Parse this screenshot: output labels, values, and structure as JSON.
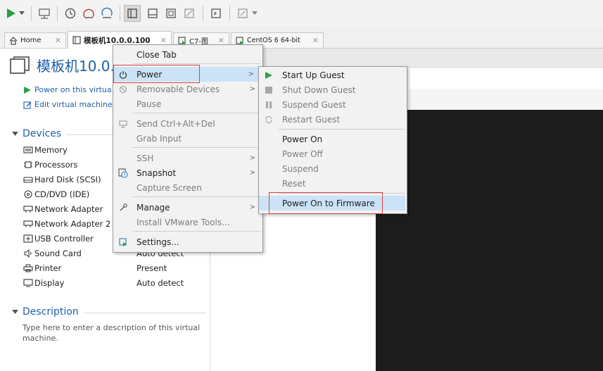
{
  "toolbar": {
    "play_icon": "play-icon",
    "colors": {
      "play": "#2ea043"
    }
  },
  "tabs": [
    {
      "label": "Home",
      "icon": "home-icon"
    },
    {
      "label": "模板机10.0.0.100",
      "icon": "vm-icon"
    },
    {
      "label": "C7-图",
      "icon": "vm-icon"
    },
    {
      "label": "CentOS 6 64-bit",
      "icon": "vm-icon"
    }
  ],
  "vm": {
    "title": "模板机10.0.",
    "power_on_link": "Power on this virtua",
    "edit_link": "Edit virtual machine"
  },
  "devices": {
    "heading": "Devices",
    "rows": [
      {
        "name": "Memory",
        "value": "",
        "icon": "memory-icon"
      },
      {
        "name": "Processors",
        "value": "",
        "icon": "processor-icon"
      },
      {
        "name": "Hard Disk (SCSI)",
        "value": "",
        "icon": "harddisk-icon"
      },
      {
        "name": "CD/DVD (IDE)",
        "value": "",
        "icon": "cd-icon"
      },
      {
        "name": "Network Adapter",
        "value": "",
        "icon": "network-icon"
      },
      {
        "name": "Network Adapter 2",
        "value": "",
        "icon": "network-icon"
      },
      {
        "name": "USB Controller",
        "value": "",
        "icon": "usb-icon"
      },
      {
        "name": "Sound Card",
        "value": "Auto detect",
        "icon": "sound-icon"
      },
      {
        "name": "Printer",
        "value": "Present",
        "icon": "printer-icon"
      },
      {
        "name": "Display",
        "value": "Auto detect",
        "icon": "display-icon"
      }
    ]
  },
  "description": {
    "heading": "Description",
    "text": "Type here to enter a description of this virtual machine."
  },
  "context_menu": {
    "items": [
      {
        "label": "Close Tab",
        "enabled": true
      },
      {
        "label": "Power",
        "enabled": true,
        "submenu": true,
        "highlighted": true,
        "icon": "power-icon"
      },
      {
        "label": "Removable Devices",
        "enabled": false,
        "submenu": true,
        "icon": "removable-icon"
      },
      {
        "label": "Pause",
        "enabled": false
      },
      {
        "label": "Send Ctrl+Alt+Del",
        "enabled": false,
        "icon": "keyboard-icon"
      },
      {
        "label": "Grab Input",
        "enabled": false
      },
      {
        "label": "SSH",
        "enabled": false,
        "submenu": true
      },
      {
        "label": "Snapshot",
        "enabled": true,
        "submenu": true,
        "icon": "snapshot-icon"
      },
      {
        "label": "Capture Screen",
        "enabled": false
      },
      {
        "label": "Manage",
        "enabled": true,
        "submenu": true,
        "icon": "manage-icon"
      },
      {
        "label": "Install VMware Tools...",
        "enabled": false
      },
      {
        "label": "Settings...",
        "enabled": true,
        "icon": "settings-icon"
      }
    ]
  },
  "power_submenu": {
    "items": [
      {
        "label": "Start Up Guest",
        "enabled": true,
        "icon": "play-icon"
      },
      {
        "label": "Shut Down Guest",
        "enabled": false,
        "icon": "stop-icon"
      },
      {
        "label": "Suspend Guest",
        "enabled": false,
        "icon": "pause-icon"
      },
      {
        "label": "Restart Guest",
        "enabled": false,
        "icon": "restart-icon"
      },
      {
        "label": "Power On",
        "enabled": true
      },
      {
        "label": "Power Off",
        "enabled": false
      },
      {
        "label": "Suspend",
        "enabled": false
      },
      {
        "label": "Reset",
        "enabled": false
      },
      {
        "label": "Power On to Firmware",
        "enabled": true,
        "highlighted": true
      }
    ]
  }
}
